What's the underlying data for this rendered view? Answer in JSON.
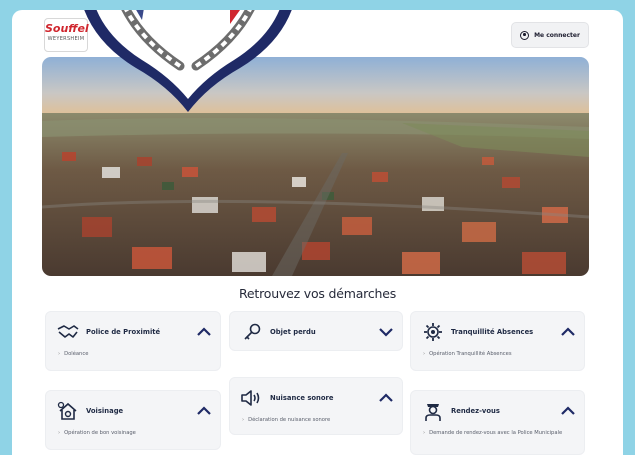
{
  "header": {
    "logo_line1": "Souffel",
    "logo_line2": "WEYERSHEIM",
    "login_label": "Me connecter"
  },
  "main": {
    "section_title": "Retrouvez vos démarches",
    "cards": [
      {
        "title": "Police de Proximité",
        "item": "Doléance",
        "icon": "handshake-icon",
        "chevron": "up"
      },
      {
        "title": "Objet perdu",
        "item": "",
        "icon": "key-icon",
        "chevron": "down"
      },
      {
        "title": "Tranquillité Absences",
        "item": "Opération Tranquillité Absences",
        "icon": "gear-icon",
        "chevron": "up"
      },
      {
        "title": "Voisinage",
        "item": "Opération de bon voisinage",
        "icon": "house-gear-icon",
        "chevron": "up"
      },
      {
        "title": "Nuisance sonore",
        "item": "Déclaration de nuisance sonore",
        "icon": "speaker-icon",
        "chevron": "up"
      },
      {
        "title": "Rendez-vous",
        "item": "Demande de rendez-vous avec la Police Municipale",
        "icon": "police-officer-icon",
        "chevron": "up"
      }
    ]
  },
  "colors": {
    "background": "#8fd3e6",
    "accent_navy": "#1f2a66",
    "crest_red": "#d0262e",
    "text_dark": "#1f2a44"
  }
}
